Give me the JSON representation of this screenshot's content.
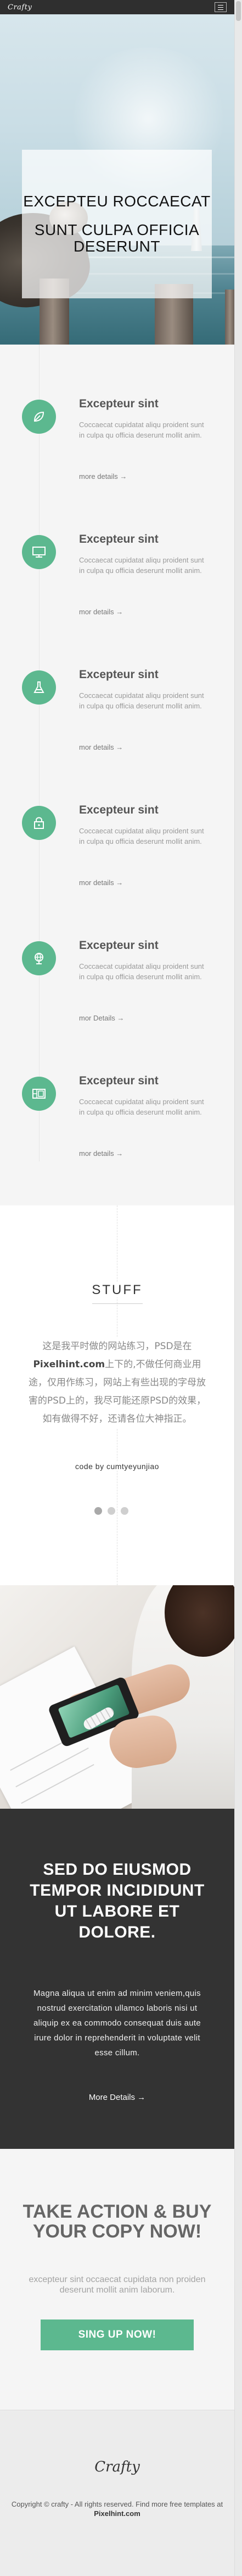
{
  "header": {
    "logo": "Crafty",
    "menu_icon": "hamburger-icon"
  },
  "hero": {
    "line1": "EXCEPTEU ROCCAECAT",
    "line2": "SUNT CULPA OFFICIA DESERUNT"
  },
  "services": [
    {
      "icon": "leaf-icon",
      "title": "Excepteur sint",
      "desc": "Coccaecat cupidatat aliqu proident sunt in culpa qu officia deserunt mollit anim.",
      "link": "more details  →"
    },
    {
      "icon": "monitor-icon",
      "title": "Excepteur sint",
      "desc": "Coccaecat cupidatat aliqu proident sunt in culpa qu officia deserunt mollit anim.",
      "link": "mor details  →"
    },
    {
      "icon": "flask-icon",
      "title": "Excepteur sint",
      "desc": "Coccaecat cupidatat aliqu proident sunt in culpa qu officia deserunt mollit anim.",
      "link": "mor details  →"
    },
    {
      "icon": "lock-icon",
      "title": "Excepteur sint",
      "desc": "Coccaecat cupidatat aliqu proident sunt in culpa qu officia deserunt mollit anim.",
      "link": "mor details  →"
    },
    {
      "icon": "globe-icon",
      "title": "Excepteur sint",
      "desc": "Coccaecat cupidatat aliqu proident sunt in culpa qu officia deserunt mollit anim.",
      "link": "mor Details  →"
    },
    {
      "icon": "gallery-icon",
      "title": "Excepteur sint",
      "desc": "Coccaecat cupidatat aliqu proident sunt in culpa qu officia deserunt mollit anim.",
      "link": "mor details  →"
    }
  ],
  "stuff": {
    "title": "STUFF",
    "text_before": "这是我平时做的网站练习，PSD是在",
    "text_bold": "Pixelhint.com",
    "text_after": "上下的,不做任何商业用途，仅用作练习，网站上有些出现的字母放害的PSD上的，我尽可能还原PSD的效果，如有做得不好，还请各位大神指正。",
    "author": "code by cumtyeyunjiao"
  },
  "dark": {
    "title": "SED DO EIUSMOD TEMPOR INCIDIDUNT UT LABORE ET DOLORE.",
    "text": "Magna aliqua ut enim ad minim veniem,quis nostrud exercitation ullamco laboris nisi ut aliquip ex ea commodo consequat duis aute irure dolor in reprehenderit in voluptate velit esse cillum.",
    "link": "More Details →"
  },
  "cta": {
    "title": "TAKE ACTION & BUY YOUR COPY NOW!",
    "subtitle": "excepteur sint occaecat cupidata non proiden deserunt mollit anim laborum.",
    "button": "SING UP NOW!"
  },
  "footer": {
    "logo": "Crafty",
    "text_before": "Copyright © crafty - All rights reserved. Find more free templates at ",
    "text_bold": "Pixelhint.com"
  },
  "colors": {
    "accent": "#5cb88f",
    "dark_panel": "#333333",
    "header": "#2f2f2f"
  }
}
